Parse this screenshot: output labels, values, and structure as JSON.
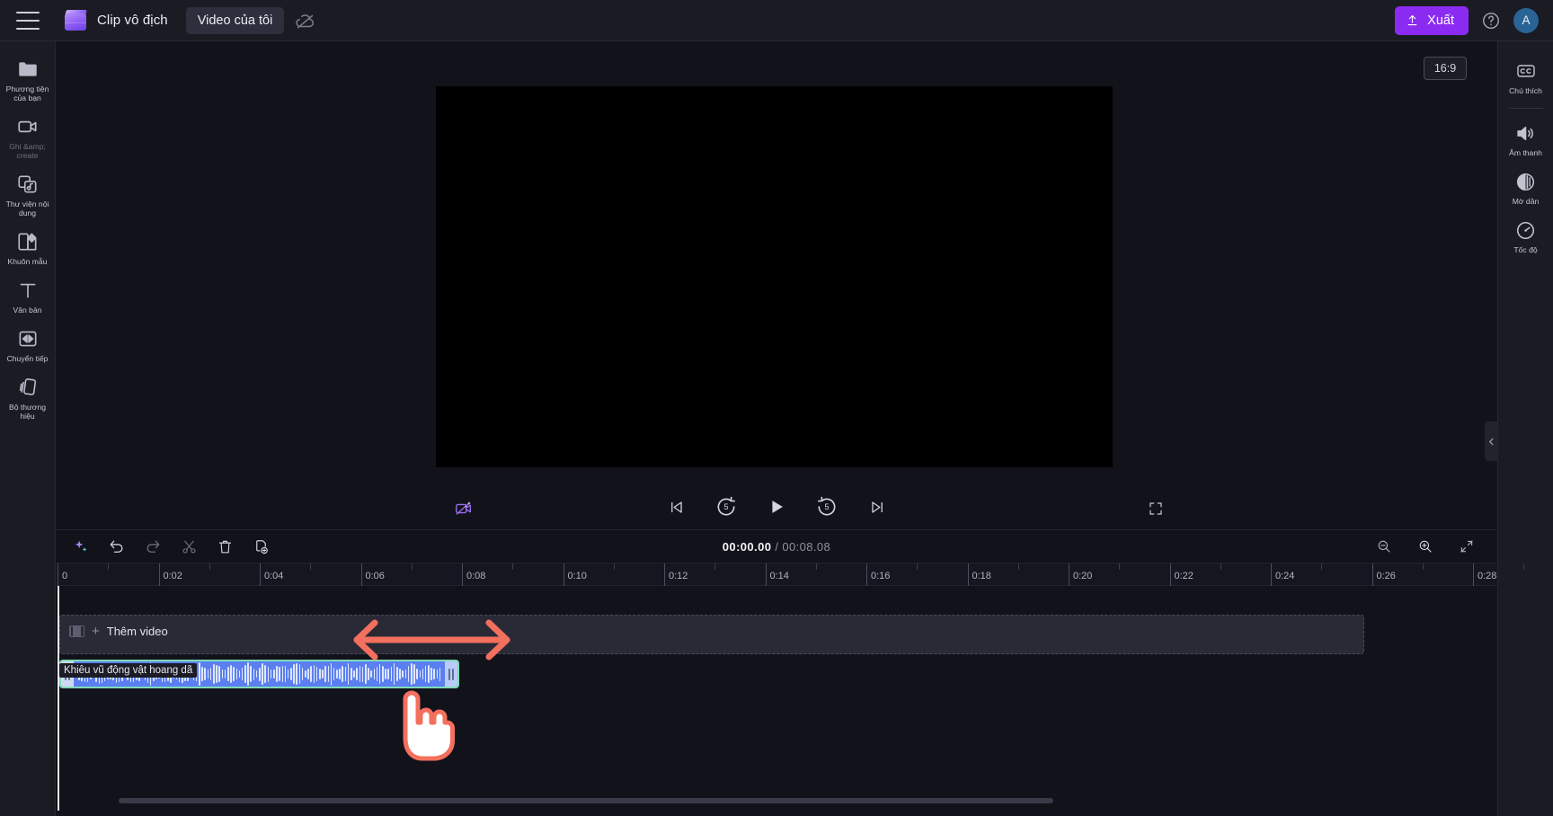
{
  "topbar": {
    "menu_icon": "hamburger-icon",
    "app_title": "Clip vô địch",
    "project_name": "Video của tôi",
    "cloud_icon": "cloud-off-icon",
    "export_label": "Xuất",
    "export_icon": "upload-icon",
    "help_icon": "help-circle-icon",
    "avatar_initial": "A",
    "accent_color": "#8b2bf2"
  },
  "left_rail": {
    "items": [
      {
        "label": "Phương tiện của bạn",
        "icon": "folder-icon",
        "dim": false
      },
      {
        "label": "Ghi &amp; create",
        "icon": "video-camera-icon",
        "dim": true
      },
      {
        "label": "Thư viện nội dung",
        "icon": "content-library-icon",
        "dim": false
      },
      {
        "label": "Khuôn mẫu",
        "icon": "templates-icon",
        "dim": false
      },
      {
        "label": "Văn bản",
        "icon": "text-icon",
        "dim": false
      },
      {
        "label": "Chuyển tiếp",
        "icon": "transitions-icon",
        "dim": false
      },
      {
        "label": "Bộ thương hiệu",
        "icon": "brand-kit-icon",
        "dim": false
      }
    ]
  },
  "right_rail": {
    "items": [
      {
        "label": "Chú thích",
        "icon": "closed-caption-icon"
      },
      {
        "label": "Âm thanh",
        "icon": "speaker-icon"
      },
      {
        "label": "Mờ dần",
        "icon": "fade-icon"
      },
      {
        "label": "Tốc độ",
        "icon": "speed-gauge-icon"
      }
    ]
  },
  "preview": {
    "aspect_ratio": "16:9",
    "stage_color": "#000000"
  },
  "player_controls": {
    "ai_effect_icon": "magic-camera-off-icon",
    "skip_prev_icon": "skip-previous-icon",
    "rewind_label": "5",
    "rewind_icon": "rewind-5-icon",
    "play_icon": "play-icon",
    "forward_label": "5",
    "forward_icon": "forward-5-icon",
    "skip_next_icon": "skip-next-icon",
    "fullscreen_icon": "fullscreen-icon"
  },
  "timeline": {
    "toolbar": [
      {
        "name": "ai-magic-button",
        "icon": "sparkle-icon",
        "dim": false
      },
      {
        "name": "undo-button",
        "icon": "undo-icon",
        "dim": false
      },
      {
        "name": "redo-button",
        "icon": "redo-icon",
        "dim": true
      },
      {
        "name": "split-button",
        "icon": "scissors-icon",
        "dim": true
      },
      {
        "name": "delete-button",
        "icon": "trash-icon",
        "dim": false
      },
      {
        "name": "duplicate-button",
        "icon": "duplicate-icon",
        "dim": false
      }
    ],
    "current_time": "00:00.00",
    "separator": "/",
    "total_time": "00:08.08",
    "zoom_out_icon": "zoom-out-icon",
    "zoom_in_icon": "zoom-in-icon",
    "fit_icon": "fit-to-screen-icon",
    "ruler_labels": [
      "0",
      "0:02",
      "0:04",
      "0:06",
      "0:08",
      "0:10",
      "0:12",
      "0:14",
      "0:16",
      "0:18",
      "0:20",
      "0:22",
      "0:24",
      "0:26",
      "0:28"
    ],
    "video_track": {
      "add_label": "Thêm video",
      "add_icon": "plus-icon",
      "thumb_icon": "film-strip-icon"
    },
    "audio_clip": {
      "label": "Khiêu vũ động vật hoang dã",
      "selected": true,
      "fill_color": "#5b7ff0",
      "selection_color": "#7fdbb6"
    }
  },
  "annotations": {
    "arrow": {
      "name": "resize-arrow-annotation",
      "color": "#f4705e"
    },
    "hand": {
      "name": "hand-cursor-annotation",
      "color": "#f4705e"
    }
  }
}
